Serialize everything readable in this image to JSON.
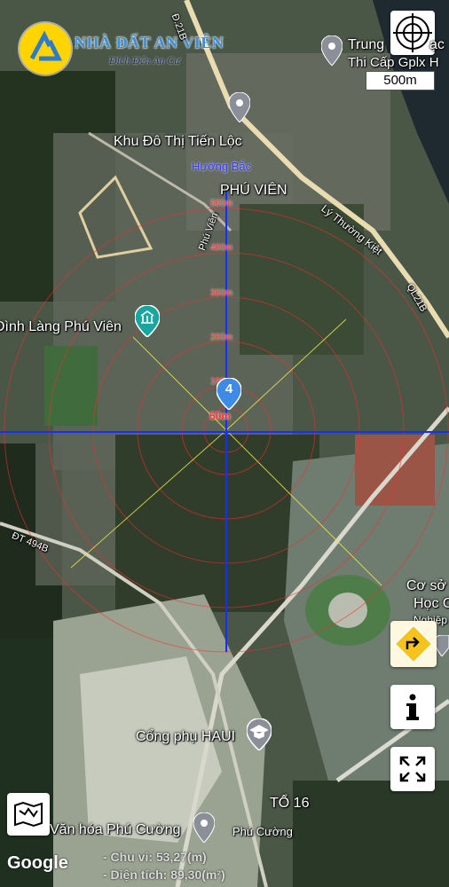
{
  "brand": {
    "name": "NHÀ ĐẤT AN VIÊN",
    "tagline": "Đích Đến An Cư"
  },
  "scale_bar": "500m",
  "places": {
    "trung_tam": "Trung",
    "trung_tam_2": "ạc",
    "thi_cap": "Thi Cấp Gplx H",
    "khu_do_thi": "Khu Đô Thị Tiến Lộc",
    "phu_vien": "PHÚ VIÊN",
    "dinh_lang": "Đình Làng Phú Viên",
    "co_so": "Cơ sở",
    "hoc": "Học C",
    "nghiep": "Nghiệp",
    "cong_phu": "Cổng phụ HAUI",
    "to16": "TỔ 16",
    "van_hoa": "Văn hóa Phú Cường",
    "phu_cuong": "Phú Cường"
  },
  "roads": {
    "huong_bac": "Hướng Bắc",
    "ly_thuong_kiet": "Lý Thường Kiệt",
    "phu_vien_rd": "Phú Viên",
    "ql21b": "QL21B",
    "dt494b": "ĐT 494B",
    "d21b": "Đ.21B"
  },
  "rings": [
    "500m",
    "400m",
    "300m",
    "200m",
    "100m",
    "50m"
  ],
  "pin_count": "4",
  "measurements": {
    "perimeter": "- Chu vi: 53,27(m)",
    "area": "- Diện tích: 89,30(m²)"
  },
  "footer": {
    "google": "Google"
  },
  "icons": [
    "compass-target-icon",
    "directions-icon",
    "info-icon",
    "fullscreen-icon",
    "map-layers-icon",
    "map-pin-icon",
    "temple-icon",
    "school-icon"
  ]
}
